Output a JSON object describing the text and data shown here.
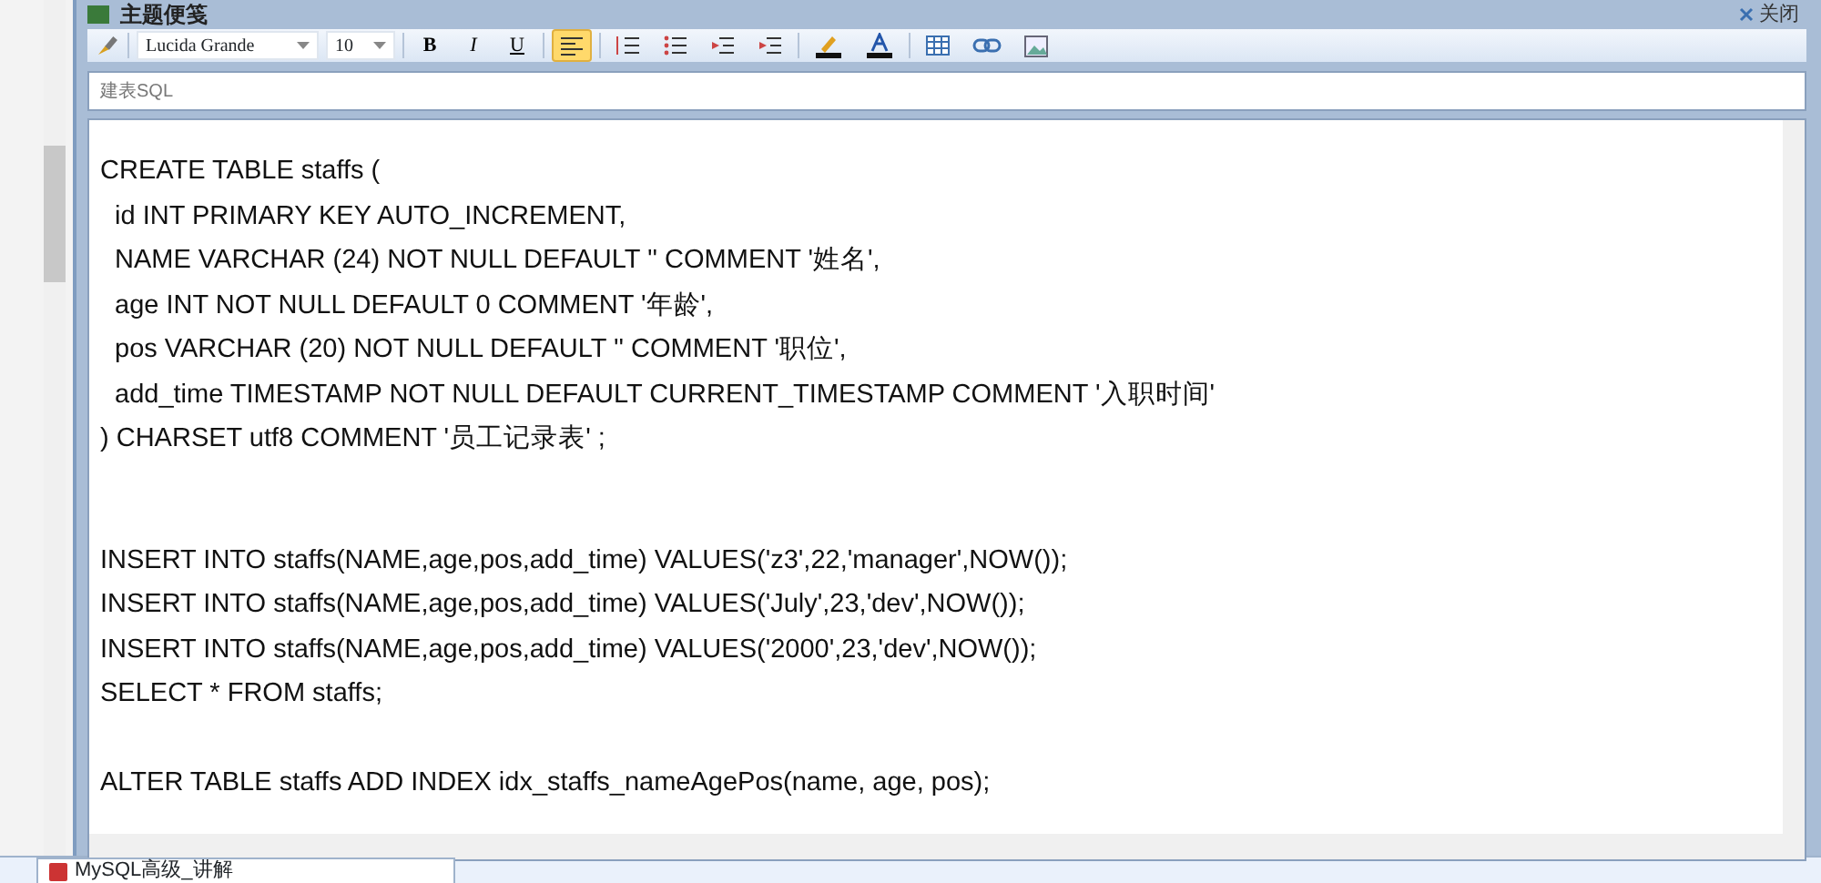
{
  "window": {
    "title": "主题便笺",
    "close_label": "关闭"
  },
  "toolbar": {
    "font": "Lucida Grande",
    "size": "10",
    "buttons": [
      {
        "kind": "bold",
        "label": "B",
        "selected": false
      },
      {
        "kind": "italic",
        "label": "I",
        "selected": false
      },
      {
        "kind": "underline",
        "label": "U",
        "selected": false
      },
      {
        "kind": "align",
        "selected": true
      },
      {
        "kind": "numbered",
        "selected": false
      },
      {
        "kind": "bullets",
        "selected": false
      },
      {
        "kind": "outdent",
        "selected": false
      },
      {
        "kind": "indent",
        "selected": false
      },
      {
        "kind": "highlight",
        "selected": false
      },
      {
        "kind": "fontcolor",
        "selected": false
      },
      {
        "kind": "table",
        "selected": false
      },
      {
        "kind": "link",
        "selected": false
      },
      {
        "kind": "image",
        "selected": false
      }
    ]
  },
  "subject": "建表SQL",
  "blocks": [
    {
      "lines": [
        {
          "text": "CREATE TABLE staffs (",
          "indent": false
        },
        {
          "text": "id INT PRIMARY KEY AUTO_INCREMENT,",
          "indent": true
        },
        {
          "text": "NAME VARCHAR (24) NOT NULL DEFAULT '' COMMENT '姓名',",
          "indent": true
        },
        {
          "text": "age INT NOT NULL DEFAULT 0 COMMENT '年龄',",
          "indent": true
        },
        {
          "text": "pos VARCHAR (20) NOT NULL DEFAULT '' COMMENT '职位',",
          "indent": true
        },
        {
          "text": "add_time TIMESTAMP NOT NULL DEFAULT CURRENT_TIMESTAMP COMMENT '入职时间'",
          "indent": true
        },
        {
          "text": ") CHARSET utf8 COMMENT '员工记录表' ;",
          "indent": false
        }
      ]
    },
    {
      "lines": [
        {
          "text": "INSERT INTO staffs(NAME,age,pos,add_time) VALUES('z3',22,'manager',NOW());",
          "indent": false
        },
        {
          "text": "INSERT INTO staffs(NAME,age,pos,add_time) VALUES('July',23,'dev',NOW());",
          "indent": false
        },
        {
          "text": "INSERT INTO staffs(NAME,age,pos,add_time) VALUES('2000',23,'dev',NOW());",
          "indent": false
        },
        {
          "text": "SELECT * FROM staffs;",
          "indent": false
        }
      ]
    },
    {
      "lines": [
        {
          "text": "ALTER TABLE staffs ADD INDEX idx_staffs_nameAgePos(name, age, pos);",
          "indent": false
        }
      ]
    }
  ],
  "taskbar": {
    "tab": "MySQL高级_讲解"
  }
}
